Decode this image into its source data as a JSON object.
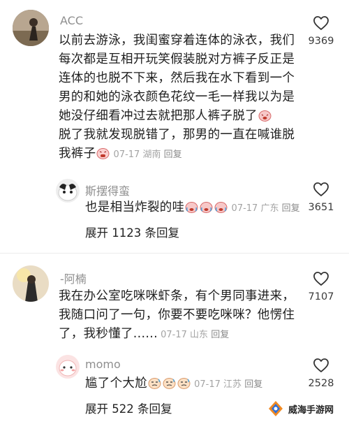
{
  "comments": [
    {
      "username": "ACC",
      "lines": [
        "以前去游泳，我闺蜜穿着连体的泳衣，我们",
        "每次都是互相开玩笑假装脱对方裤子反正是",
        "连体的也脱不下来，然后我在水下看到一个",
        "男的和她的泳衣颜色花纹一毛一样我以为是",
        "她没仔细看冲过去就把那人裤子脱了",
        "脱了我就发现脱错了，那男的一直在喊谁脱",
        "我裤子"
      ],
      "meta": "07-17 湖南",
      "reply_label": "回复",
      "likes": "9369",
      "reply": {
        "username": "斯摆得蛮",
        "text": "也是相当炸裂的哇",
        "meta": "07-17 广东",
        "reply_label": "回复",
        "likes": "3651"
      },
      "expand_label": "展开 1123 条回复"
    },
    {
      "username": "-阿楠",
      "lines": [
        "我在办公室吃咪咪虾条，有个男同事进来，",
        "我随口问了一句，你要不要吃咪咪？他愣住",
        "了，我秒懂了......"
      ],
      "meta": "07-17 山东",
      "reply_label": "回复",
      "likes": "7107",
      "reply": {
        "username": "momo",
        "text": "尴了个大尬",
        "meta": "07-17 江苏",
        "reply_label": "回复",
        "likes": "2528"
      },
      "expand_label": "展开 522 条回复"
    }
  ],
  "watermark": {
    "text": "威海手游网"
  },
  "icons": {
    "like": "heart-outline-icon",
    "emoji_laugh": "laugh-cry-emoji",
    "emoji_cry": "crying-emoji"
  },
  "colors": {
    "name": "#8f8f8f",
    "meta": "#a3a3a3",
    "text": "#1e1e1e"
  }
}
